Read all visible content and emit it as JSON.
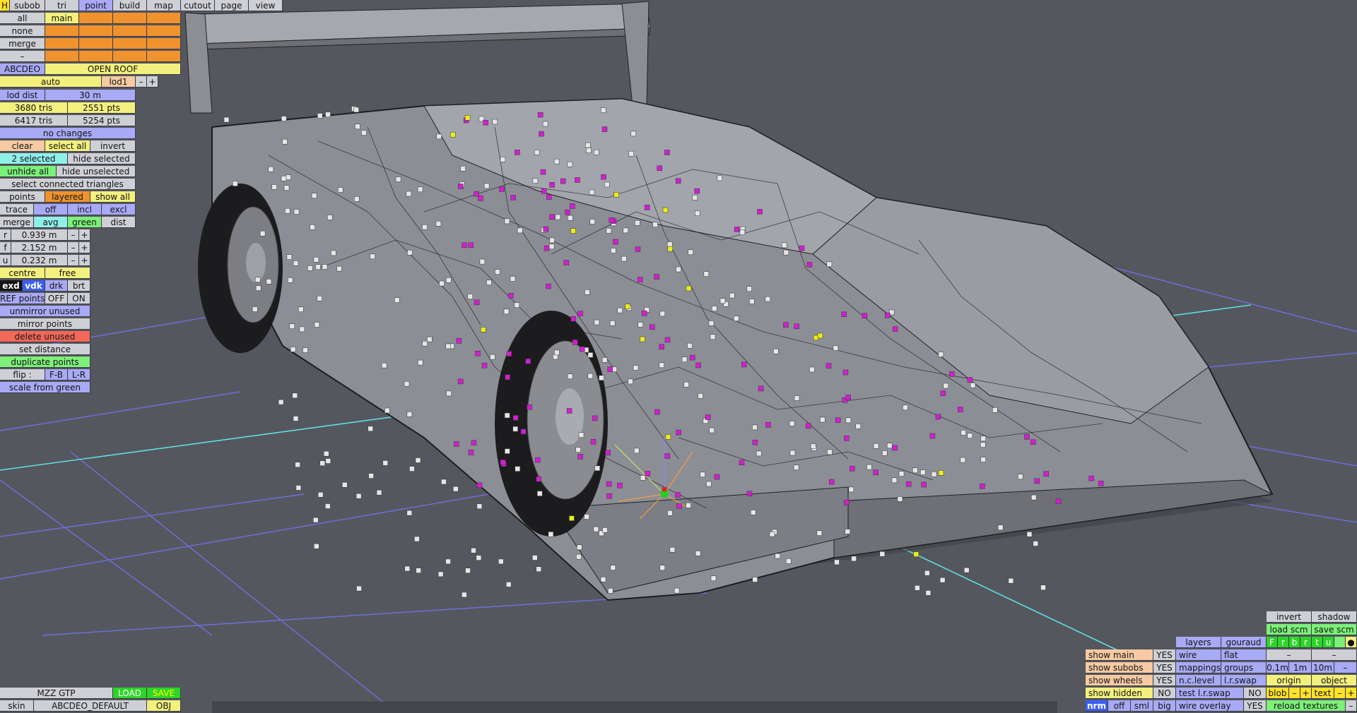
{
  "menu": {
    "h": "H",
    "subob": "subob",
    "tri": "tri",
    "point": "point",
    "build": "build",
    "map": "map",
    "cutout": "cutout",
    "page": "page",
    "view": "view"
  },
  "selection": {
    "all": "all",
    "main": "main",
    "none": "none",
    "merge": "merge",
    "dash": "–",
    "abcdeo": "ABCDEO",
    "open_roof": "OPEN ROOF"
  },
  "lod": {
    "auto": "auto",
    "lod1": "lod1",
    "minus": "–",
    "plus": "+",
    "lod_dist_label": "lod dist",
    "lod_dist_value": "30 m"
  },
  "stats": {
    "tris_a": "3680 tris",
    "pts_a": "2551 pts",
    "tris_b": "6417 tris",
    "pts_b": "5254 pts",
    "no_changes": "no changes"
  },
  "select": {
    "clear": "clear",
    "select_all": "select all",
    "invert": "invert",
    "selected": "2 selected",
    "hide_selected": "hide selected",
    "unhide_all": "unhide all",
    "hide_unselected": "hide unselected",
    "connected": "select connected triangles"
  },
  "points_row": {
    "points": "points",
    "layered": "layered",
    "show_all": "show all"
  },
  "trace_row": {
    "trace": "trace",
    "off": "off",
    "incl": "incl",
    "excl": "excl"
  },
  "merge_row": {
    "merge": "merge",
    "avg": "avg",
    "green": "green",
    "dist": "dist"
  },
  "coords": [
    {
      "axis": "r",
      "value": "0.939 m",
      "minus": "–",
      "plus": "+"
    },
    {
      "axis": "f",
      "value": "2.152 m",
      "minus": "–",
      "plus": "+"
    },
    {
      "axis": "u",
      "value": "0.232 m",
      "minus": "–",
      "plus": "+"
    }
  ],
  "pivot": {
    "centre": "centre",
    "free": "free"
  },
  "shade": {
    "exd": "exd",
    "vdk": "vdk",
    "drk": "drk",
    "brt": "brt"
  },
  "ref": {
    "label": "REF points",
    "off": "OFF",
    "on": "ON"
  },
  "actions": {
    "unmirror": "unmirror unused",
    "mirror": "mirror points",
    "delete": "delete unused",
    "set_distance": "set distance",
    "duplicate": "duplicate points",
    "flip": "flip :",
    "fb": "F-B",
    "lr": "L-R",
    "scale": "scale from green"
  },
  "footer": {
    "model": "MZZ GTP",
    "load": "LOAD",
    "save": "SAVE",
    "skin": "skin",
    "skin_name": "ABCDEO_DEFAULT",
    "obj": "OBJ"
  },
  "bottom_right": {
    "invert": "invert",
    "shadow": "shadow",
    "load_scm": "load scm",
    "save_scm": "save scm",
    "channels": [
      "F",
      "r",
      "b",
      "r",
      "t",
      "u"
    ],
    "dot": "●",
    "layers": "layers",
    "gouraud": "gouraud",
    "dash": "–",
    "show_main": "show main",
    "show_subobs": "show subobs",
    "show_wheels": "show wheels",
    "show_hidden": "show hidden",
    "yes": "YES",
    "no": "NO",
    "wire": "wire",
    "flat": "flat",
    "mappings": "mappings",
    "groups": "groups",
    "ncl": "n.c.level",
    "lrswap": "l.r.swap",
    "test_lrswap": "test l.r.swap",
    "wire_overlay": "wire overlay",
    "s01": "0.1m",
    "s1": "1m",
    "s10": "10m",
    "origin": "origin",
    "object": "object",
    "blob": "blob",
    "minus": "–",
    "plus": "+",
    "text": "text",
    "nrm": "nrm",
    "off": "off",
    "sml": "sml",
    "big": "big",
    "reload": "reload textures"
  },
  "colors": {
    "background": "#55575e",
    "body": "#8c8e96",
    "magenta": "#d21fd0",
    "yellow": "#ecec1c",
    "grid": "#6f6fe0",
    "cyan": "#5ee0e0"
  }
}
